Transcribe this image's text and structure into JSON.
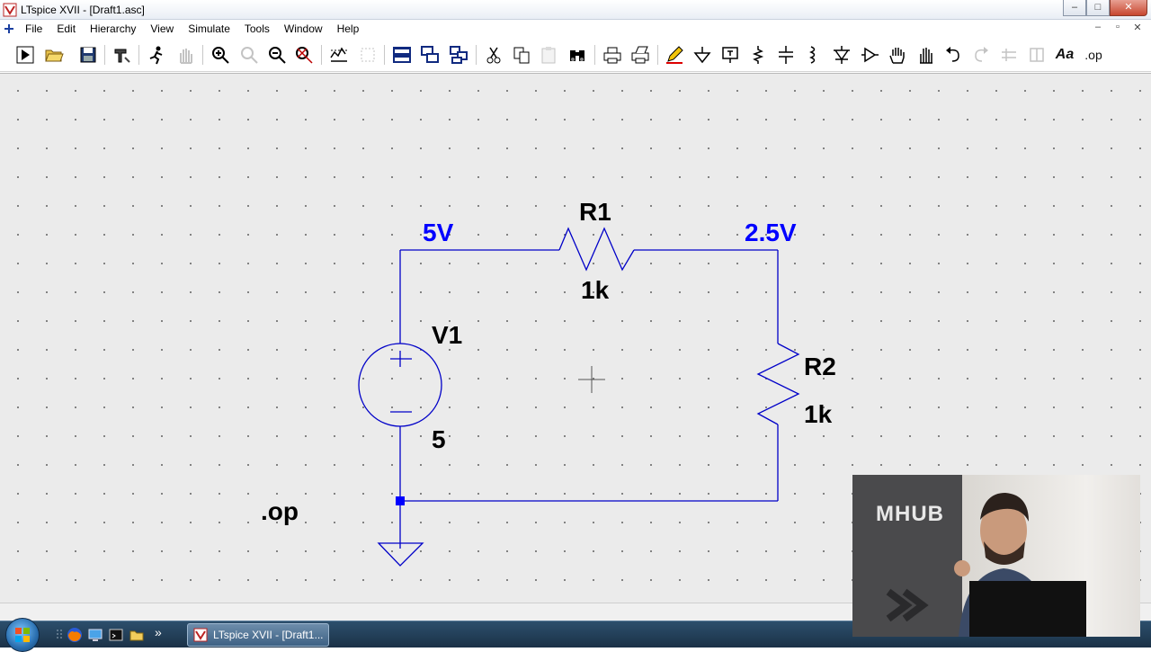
{
  "window": {
    "title": "LTspice XVII - [Draft1.asc]",
    "controls": {
      "minimize": "–",
      "maximize": "□",
      "close": "✕"
    }
  },
  "menubar": {
    "items": [
      "File",
      "Edit",
      "Hierarchy",
      "View",
      "Simulate",
      "Tools",
      "Window",
      "Help"
    ],
    "mdi_controls": {
      "minimize": "–",
      "restore": "▫",
      "close": "✕"
    }
  },
  "toolbar": {
    "text_tool_label": "Aa",
    "spice_directive_label": ".op"
  },
  "schematic": {
    "labels": {
      "node_left": "5V",
      "node_right": "2.5V",
      "r1_name": "R1",
      "r1_value": "1k",
      "r2_name": "R2",
      "r2_value": "1k",
      "v1_name": "V1",
      "v1_value": "5",
      "directive": ".op"
    },
    "colors": {
      "wire": "#0000c8",
      "node_label": "#0000ff",
      "component_text": "#000000",
      "background": "#ebebeb"
    }
  },
  "taskbar": {
    "task_button_label": "LTspice XVII - [Draft1..."
  },
  "webcam": {
    "brand": "MHUB"
  }
}
